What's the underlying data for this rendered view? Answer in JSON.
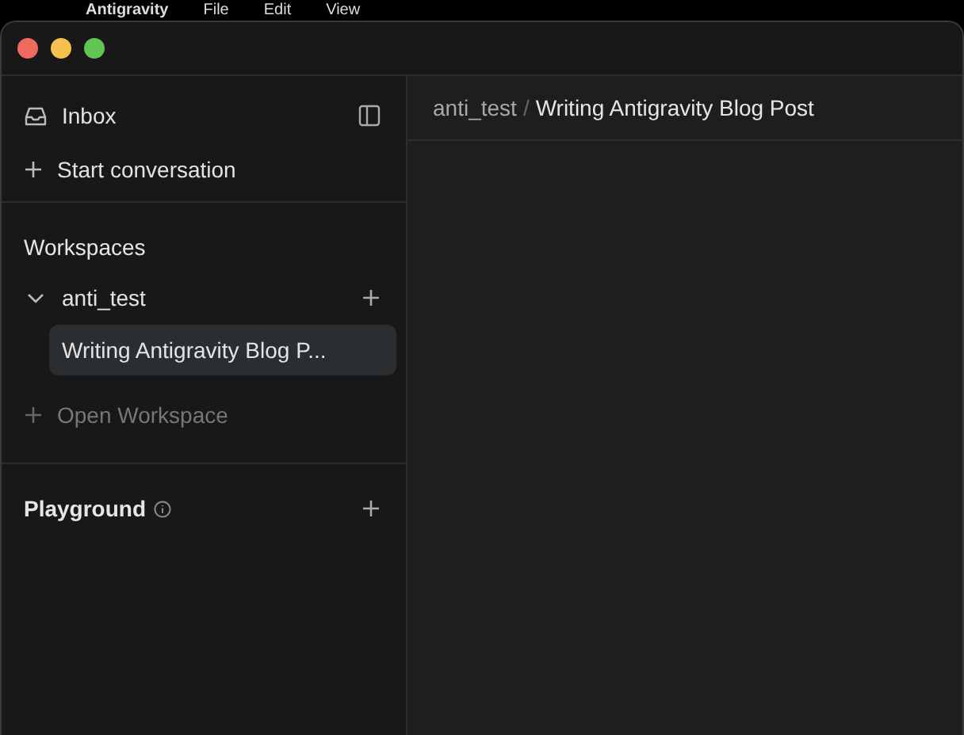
{
  "menu_bar": {
    "app_name": "Antigravity",
    "items": [
      "File",
      "Edit",
      "View"
    ]
  },
  "sidebar": {
    "inbox": "Inbox",
    "start_conversation": "Start conversation",
    "workspaces_heading": "Workspaces",
    "workspaces": [
      {
        "name": "anti_test",
        "expanded": true,
        "conversations": [
          {
            "title": "Writing Antigravity Blog P...",
            "selected": true
          }
        ]
      }
    ],
    "open_workspace": {
      "label": "Open Workspace",
      "disabled": true
    },
    "playground": "Playground"
  },
  "breadcrumb": {
    "workspace": "anti_test",
    "separator": "/",
    "title": "Writing Antigravity Blog Post"
  }
}
